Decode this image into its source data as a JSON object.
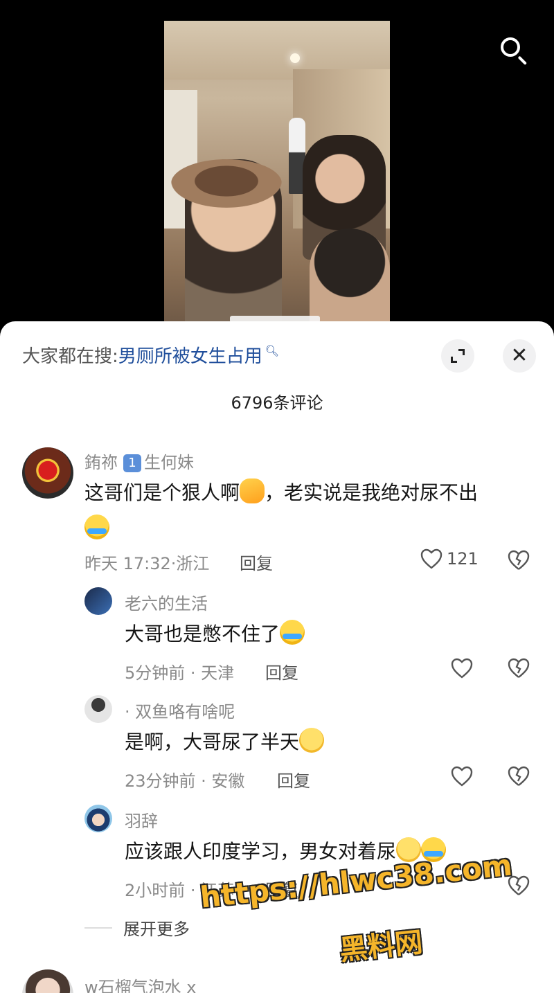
{
  "search_label": "",
  "panel": {
    "search_prefix": "大家都在搜:",
    "search_query": "男厕所被女生占用",
    "comment_count": "6796条评论"
  },
  "comments": [
    {
      "username": "銪祢",
      "badge": "1",
      "badge_text": "生何妹",
      "text_line1": "这哥们是个狠人啊",
      "text_line1b": "，老实说是我绝对尿不出",
      "time": "昨天 17:32·浙江",
      "reply": "回复",
      "likes": "121"
    }
  ],
  "replies": [
    {
      "username": "老六的生活",
      "text": "大哥也是憋不住了",
      "meta": "5分钟前 · 天津",
      "reply": "回复"
    },
    {
      "username": "· 双鱼咯有啥呢",
      "text": "是啊，大哥尿了半天",
      "meta": "23分钟前 · 安徽",
      "reply": "回复"
    },
    {
      "username": "羽辞",
      "text": "应该跟人印度学习，男女对着尿",
      "meta": "2小时前 · 江苏",
      "reply": "回复"
    }
  ],
  "expand_more": "展开更多",
  "next_comment": {
    "username": "w石榴气泡水 x"
  },
  "watermark": {
    "line1": "https://hlwc38.com",
    "line2": "黑料网"
  },
  "colors": {
    "link": "#1f4e9b",
    "watermark": "#f5b52a"
  }
}
